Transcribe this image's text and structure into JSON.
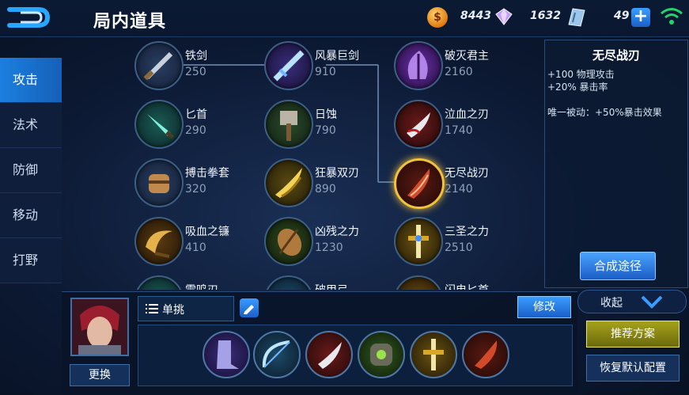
{
  "header": {
    "title": "局内道具",
    "gold": "8443",
    "diamonds": "1632",
    "vouchers": "49",
    "plus_label": "+"
  },
  "categories": [
    "攻击",
    "法术",
    "防御",
    "移动",
    "打野"
  ],
  "items": [
    {
      "name": "铁剑",
      "price": "250"
    },
    {
      "name": "风暴巨剑",
      "price": "910"
    },
    {
      "name": "破灭君主",
      "price": "2160"
    },
    {
      "name": "匕首",
      "price": "290"
    },
    {
      "name": "日蚀",
      "price": "790"
    },
    {
      "name": "泣血之刃",
      "price": "1740"
    },
    {
      "name": "搏击拳套",
      "price": "320"
    },
    {
      "name": "狂暴双刃",
      "price": "890"
    },
    {
      "name": "无尽战刃",
      "price": "2140"
    },
    {
      "name": "吸血之镰",
      "price": "410"
    },
    {
      "name": "凶残之力",
      "price": "1230"
    },
    {
      "name": "三圣之力",
      "price": "2510"
    },
    {
      "name": "雷鸣刃",
      "price": ""
    },
    {
      "name": "破甲弓",
      "price": ""
    },
    {
      "name": "闪电匕首",
      "price": ""
    }
  ],
  "detail": {
    "name": "无尽战刃",
    "stat1": "+100 物理攻击",
    "stat2": "+20% 暴击率",
    "passive": "唯一被动：+50%暴击效果",
    "compose_label": "合成途径"
  },
  "collapse_label": "收起",
  "loadout": {
    "mode_label": "单挑",
    "modify_label": "修改",
    "swap_label": "更换",
    "recommend_label": "推荐方案",
    "reset_label": "恢复默认配置"
  },
  "colors": {
    "accent_blue": "#1b7fe0",
    "selected_gold": "#f2c23a",
    "wifi_green": "#22d46a",
    "recommend_yellow": "#a5a21b"
  }
}
